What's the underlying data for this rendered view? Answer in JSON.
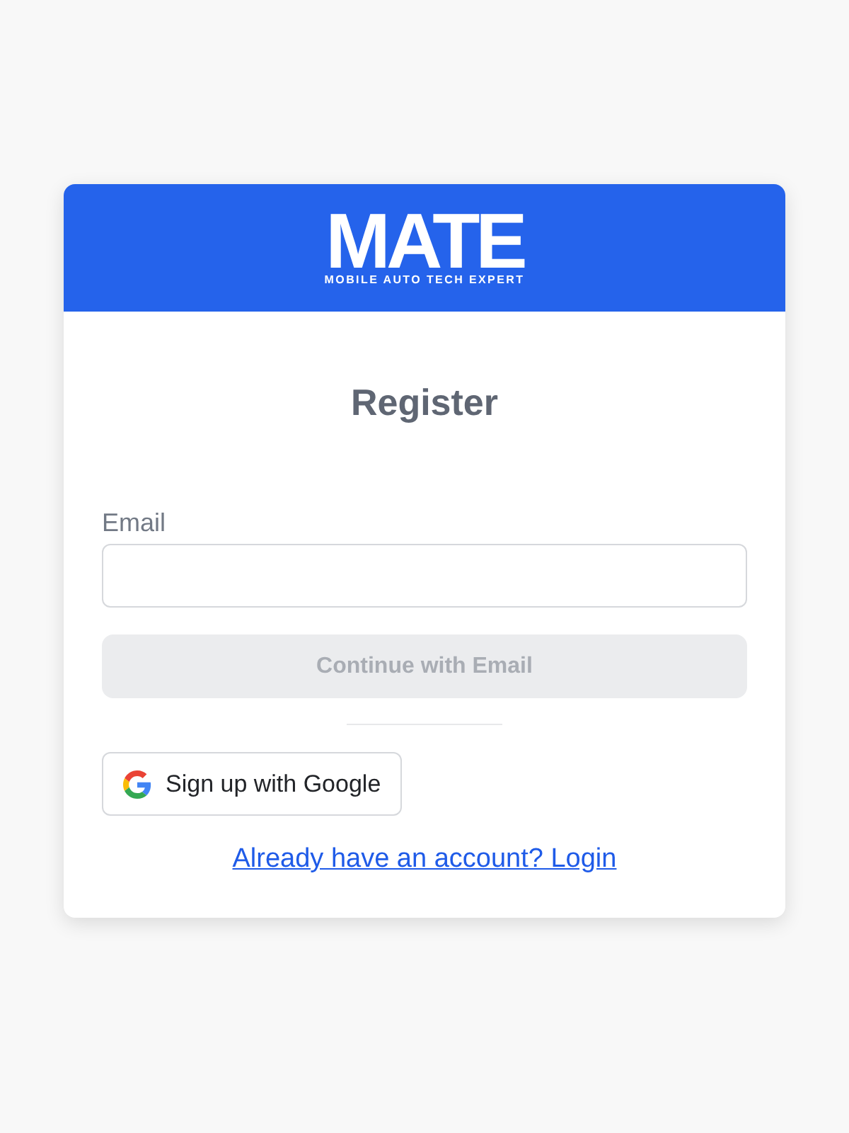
{
  "header": {
    "logo": "MATE",
    "tagline": "MOBILE AUTO TECH EXPERT"
  },
  "title": "Register",
  "email_field": {
    "label": "Email"
  },
  "continue_button": {
    "label": "Continue with Email",
    "disabled": true
  },
  "google_button": {
    "label": "Sign up with Google"
  },
  "login_link": {
    "label": "Already have an account? Login"
  }
}
